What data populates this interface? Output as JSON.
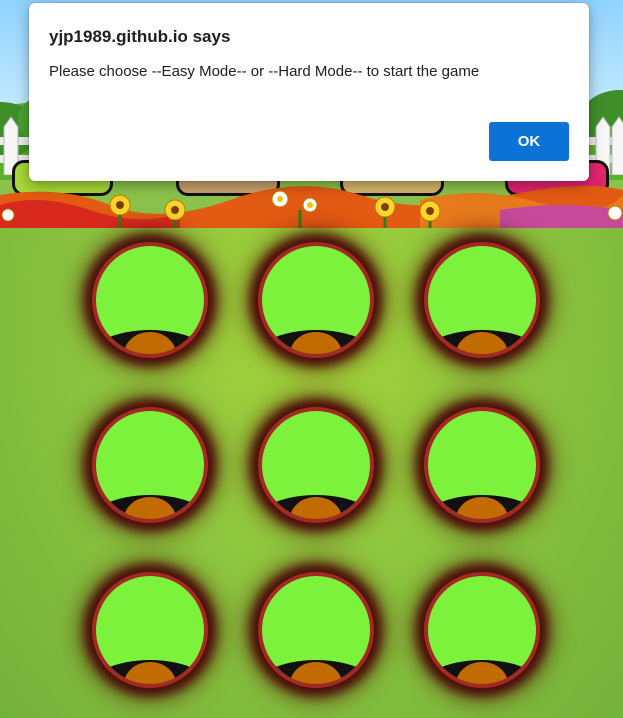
{
  "dialog": {
    "title": "yjp1989.github.io says",
    "message": "Please choose --Easy Mode-- or --Hard Mode-- to start the game",
    "ok_label": "OK"
  },
  "game": {
    "holes": 9,
    "grid": "3x3"
  },
  "colors": {
    "grass": "#8bc34a",
    "hole_fill": "#7df23d",
    "hole_rim": "#a22a22",
    "dirt_mound": "#c26b00",
    "ok_button": "#0b73d6"
  }
}
